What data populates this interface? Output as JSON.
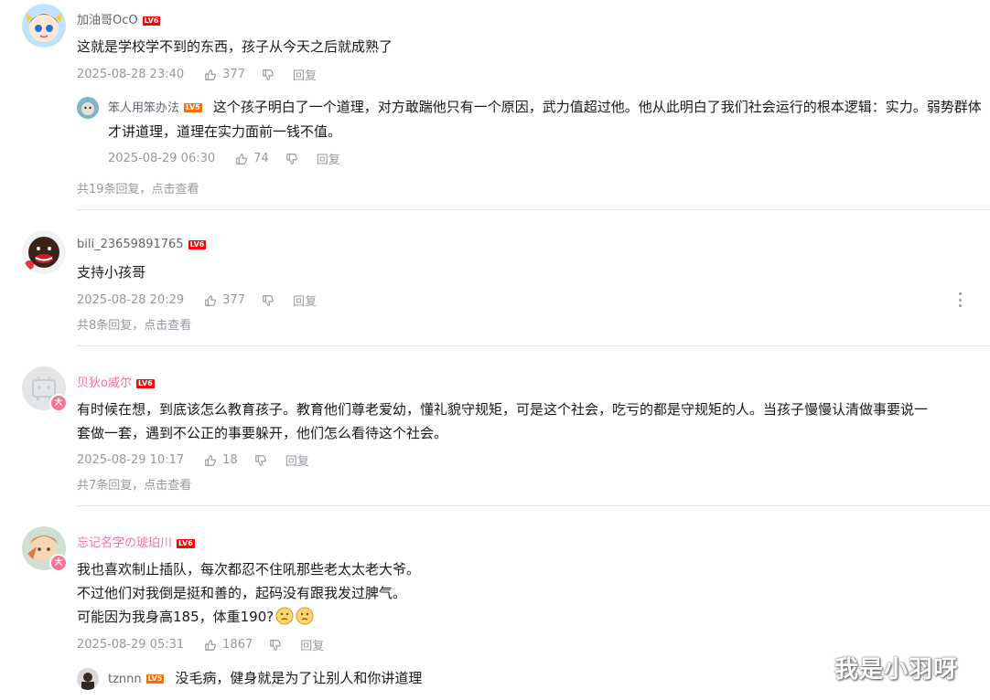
{
  "icons": {
    "like": "thumbs-up-icon",
    "dislike": "thumbs-down-icon",
    "more": "more-vertical-icon"
  },
  "colors": {
    "username": "#61666d",
    "vip_username": "#fb7299",
    "meta": "#9499a0",
    "level_badge": "#ff6c00",
    "level_badge_6": "#ff0000"
  },
  "comments": [
    {
      "username": "加油哥OcO",
      "level": "LV6",
      "text": "这就是学校学不到的东西，孩子从今天之后就成熟了",
      "time": "2025-08-28 23:40",
      "likes": "377",
      "reply_label": "回复",
      "sub_reply": {
        "username": "笨人用笨办法",
        "level": "LV5",
        "text": "这个孩子明白了一个道理，对方敢踹他只有一个原因，武力值超过他。他从此明白了我们社会运行的根本逻辑：实力。弱势群体才讲道理，道理在实力面前一钱不值。",
        "text_line1": "这个孩子明白了一个道理，对方敢踹他只有一个原因，武力值超过他。他从此明白了我们社会运行的根本逻辑：实力。弱势群体",
        "text_line2": "才讲道理，道理在实力面前一钱不值。",
        "time": "2025-08-29 06:30",
        "likes": "74",
        "reply_label": "回复"
      },
      "more_replies": "共19条回复，点击查看"
    },
    {
      "username": "bili_23659891765",
      "level": "LV6",
      "text": "支持小孩哥",
      "time": "2025-08-28 20:29",
      "likes": "377",
      "reply_label": "回复",
      "more_replies": "共8条回复，点击查看"
    },
    {
      "username": "贝狄o威尔",
      "level": "LV6",
      "avatar_badge": "大",
      "text_line1": "有时候在想，到底该怎么教育孩子。教育他们尊老爱幼，懂礼貌守规矩，可是这个社会，吃亏的都是守规矩的人。当孩子慢慢认清做事要说一",
      "text_line2": "套做一套，遇到不公正的事要躲开，他们怎么看待这个社会。",
      "time": "2025-08-29 10:17",
      "likes": "18",
      "reply_label": "回复",
      "more_replies": "共7条回复，点击查看"
    },
    {
      "username": "忘记名字の琥珀川",
      "level": "LV6",
      "avatar_badge": "大",
      "text_line1": "我也喜欢制止插队，每次都忍不住吼那些老太太老大爷。",
      "text_line2": "不过他们对我倒是挺和善的，起码没有跟我发过脾气。",
      "text_line3": "可能因为我身高185，体重190?",
      "emoji_names": [
        "thinking-emoji",
        "thinking-emoji"
      ],
      "time": "2025-08-29 05:31",
      "likes": "1867",
      "reply_label": "回复",
      "sub_reply": {
        "username": "tznnn",
        "level": "LV5",
        "text": "没毛病，健身就是为了让别人和你讲道理"
      }
    }
  ],
  "watermark": "我是小羽呀"
}
